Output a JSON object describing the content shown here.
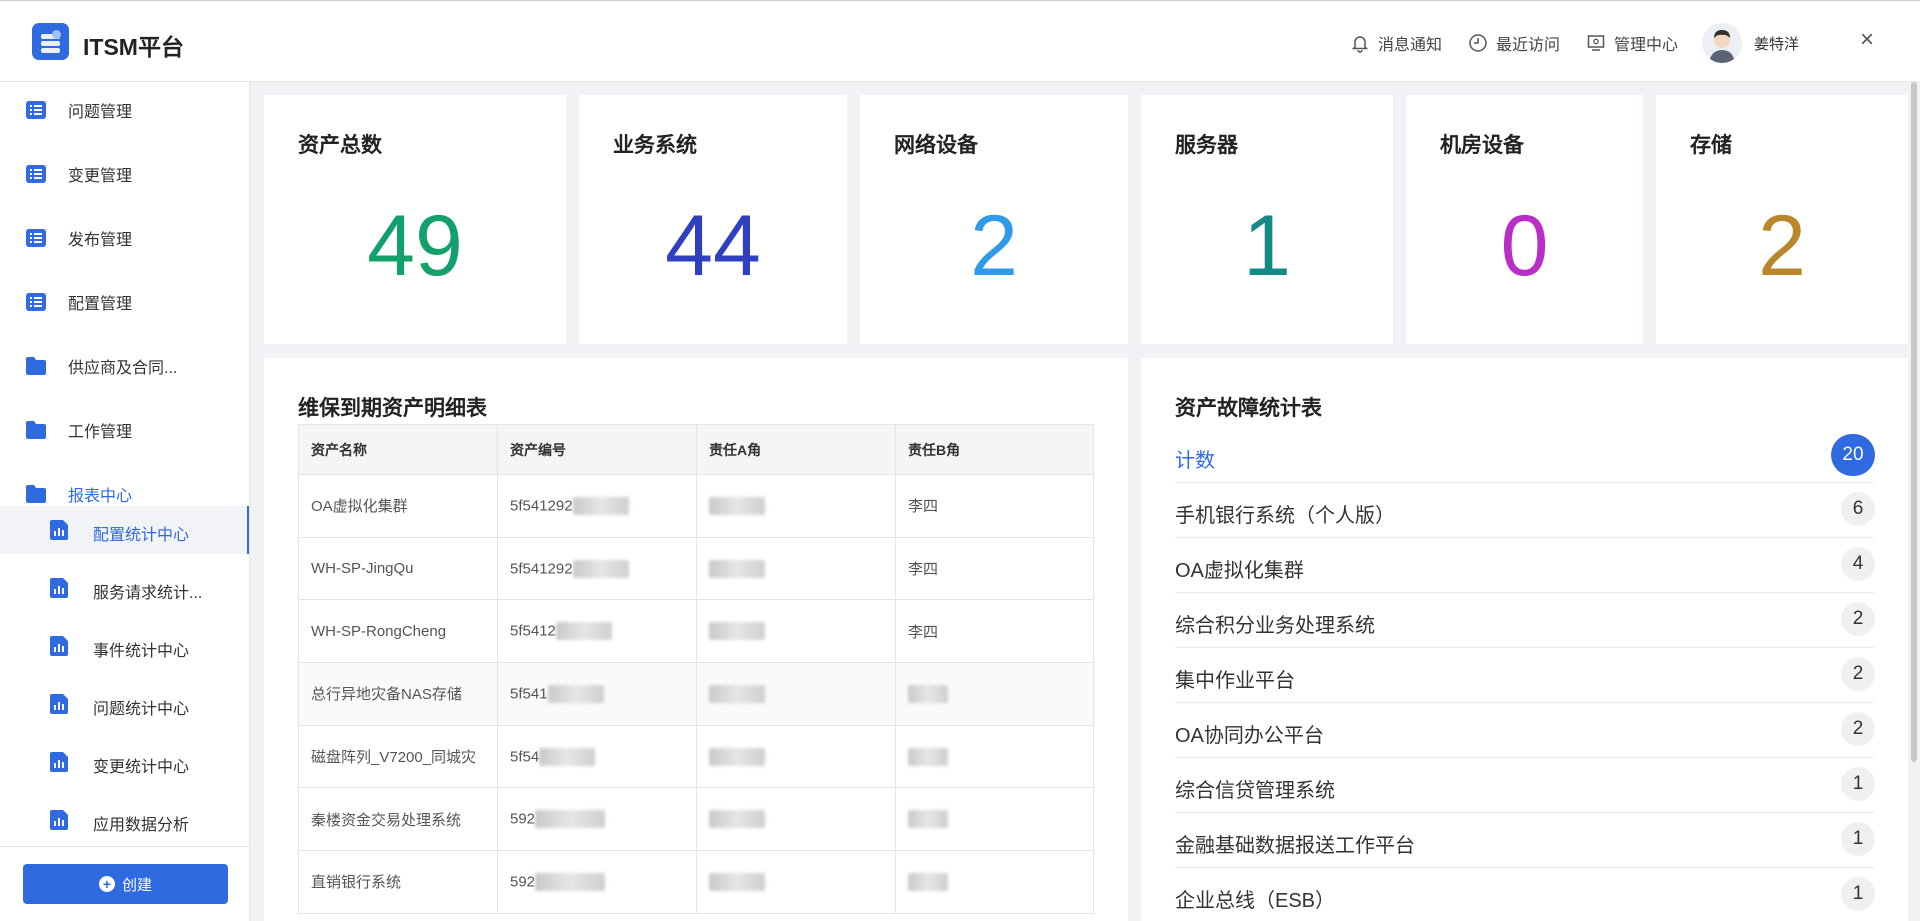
{
  "header": {
    "title": "ITSM平台",
    "notifications": "消息通知",
    "recent": "最近访问",
    "admin": "管理中心",
    "user": "姜特洋",
    "close": "×"
  },
  "sidebar": {
    "items": [
      {
        "label": "问题管理",
        "icon": "list-icon"
      },
      {
        "label": "变更管理",
        "icon": "list-icon"
      },
      {
        "label": "发布管理",
        "icon": "list-icon"
      },
      {
        "label": "配置管理",
        "icon": "list-icon"
      },
      {
        "label": "供应商及合同...",
        "icon": "folder-icon"
      },
      {
        "label": "工作管理",
        "icon": "folder-icon"
      },
      {
        "label": "报表中心",
        "icon": "folder-icon"
      }
    ],
    "sub_items": [
      {
        "label": "配置统计中心",
        "icon": "report-icon"
      },
      {
        "label": "服务请求统计...",
        "icon": "report-icon"
      },
      {
        "label": "事件统计中心",
        "icon": "report-icon"
      },
      {
        "label": "问题统计中心",
        "icon": "report-icon"
      },
      {
        "label": "变更统计中心",
        "icon": "report-icon"
      },
      {
        "label": "应用数据分析",
        "icon": "report-icon"
      }
    ],
    "create_label": "创建"
  },
  "stats": [
    {
      "title": "资产总数",
      "value": "49",
      "color": "#14a06a"
    },
    {
      "title": "业务系统",
      "value": "44",
      "color": "#2f3fbf"
    },
    {
      "title": "网络设备",
      "value": "2",
      "color": "#2f9be8"
    },
    {
      "title": "服务器",
      "value": "1",
      "color": "#138a86"
    },
    {
      "title": "机房设备",
      "value": "0",
      "color": "#b92ec7"
    },
    {
      "title": "存储",
      "value": "2",
      "color": "#b8862b"
    }
  ],
  "maintenance": {
    "title": "维保到期资产明细表",
    "columns": [
      "资产名称",
      "资产编号",
      "责任A角",
      "责任B角"
    ],
    "rows": [
      {
        "name": "OA虚拟化集群",
        "code": "5f541292",
        "a": "",
        "b": "李四"
      },
      {
        "name": "WH-SP-JingQu",
        "code": "5f541292",
        "a": "",
        "b": "李四"
      },
      {
        "name": "WH-SP-RongCheng",
        "code": "5f5412",
        "a": "",
        "b": "李四"
      },
      {
        "name": "总行异地灾备NAS存储",
        "code": "5f541",
        "a": "",
        "b": ""
      },
      {
        "name": "磁盘阵列_V7200_同城灾",
        "code": "5f54",
        "a": "",
        "b": ""
      },
      {
        "name": "秦楼资金交易处理系统",
        "code": "592",
        "a": "",
        "b": ""
      },
      {
        "name": "直销银行系统",
        "code": "592",
        "a": "",
        "b": ""
      }
    ]
  },
  "faults": {
    "title": "资产故障统计表",
    "head": {
      "name": "计数",
      "count": "20"
    },
    "rows": [
      {
        "name": "手机银行系统（个人版）",
        "count": "6"
      },
      {
        "name": "OA虚拟化集群",
        "count": "4"
      },
      {
        "name": "综合积分业务处理系统",
        "count": "2"
      },
      {
        "name": "集中作业平台",
        "count": "2"
      },
      {
        "name": "OA协同办公平台",
        "count": "2"
      },
      {
        "name": "综合信贷管理系统",
        "count": "1"
      },
      {
        "name": "金融基础数据报送工作平台",
        "count": "1"
      },
      {
        "name": "企业总线（ESB）",
        "count": "1"
      }
    ]
  },
  "accent_color": "#2f6ae0"
}
